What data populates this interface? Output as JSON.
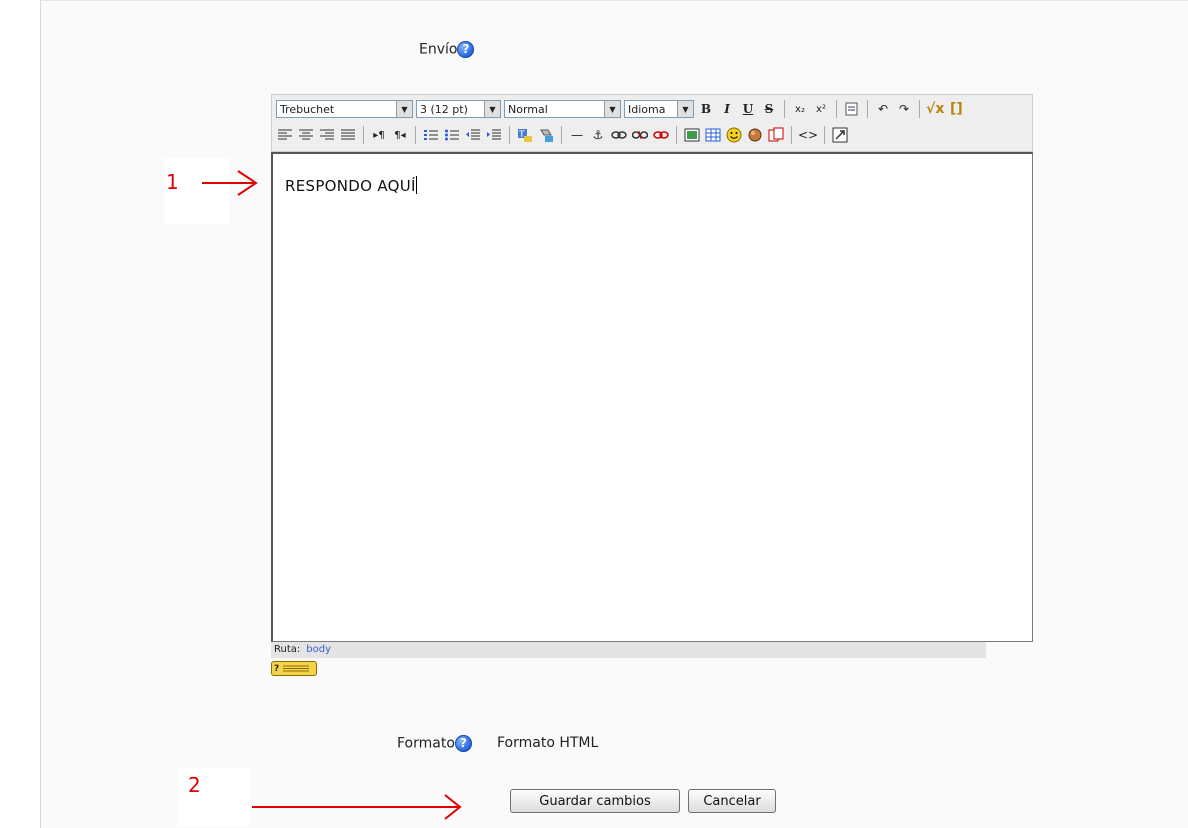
{
  "form": {
    "envio_label": "Envío",
    "formato_label": "Formato",
    "formato_value": "Formato HTML",
    "help_glyph": "?"
  },
  "toolbar": {
    "font_family": "Trebuchet",
    "font_size": "3 (12 pt)",
    "paragraph": "Normal",
    "language": "Idioma",
    "bold": "B",
    "italic": "I",
    "underline": "U",
    "strike": "S",
    "subscript": "x₂",
    "superscript": "x²",
    "hr": "—",
    "anchor": "⚓",
    "code": "<>",
    "math": "√x",
    "nolink": "[]"
  },
  "editor": {
    "content": "RESPONDO AQUÍ",
    "path_label": "Ruta:",
    "path_value": "body"
  },
  "annotations": {
    "label_1": "1",
    "label_2": "2",
    "color": "#e00000"
  },
  "buttons": {
    "save": "Guardar cambios",
    "cancel": "Cancelar"
  }
}
